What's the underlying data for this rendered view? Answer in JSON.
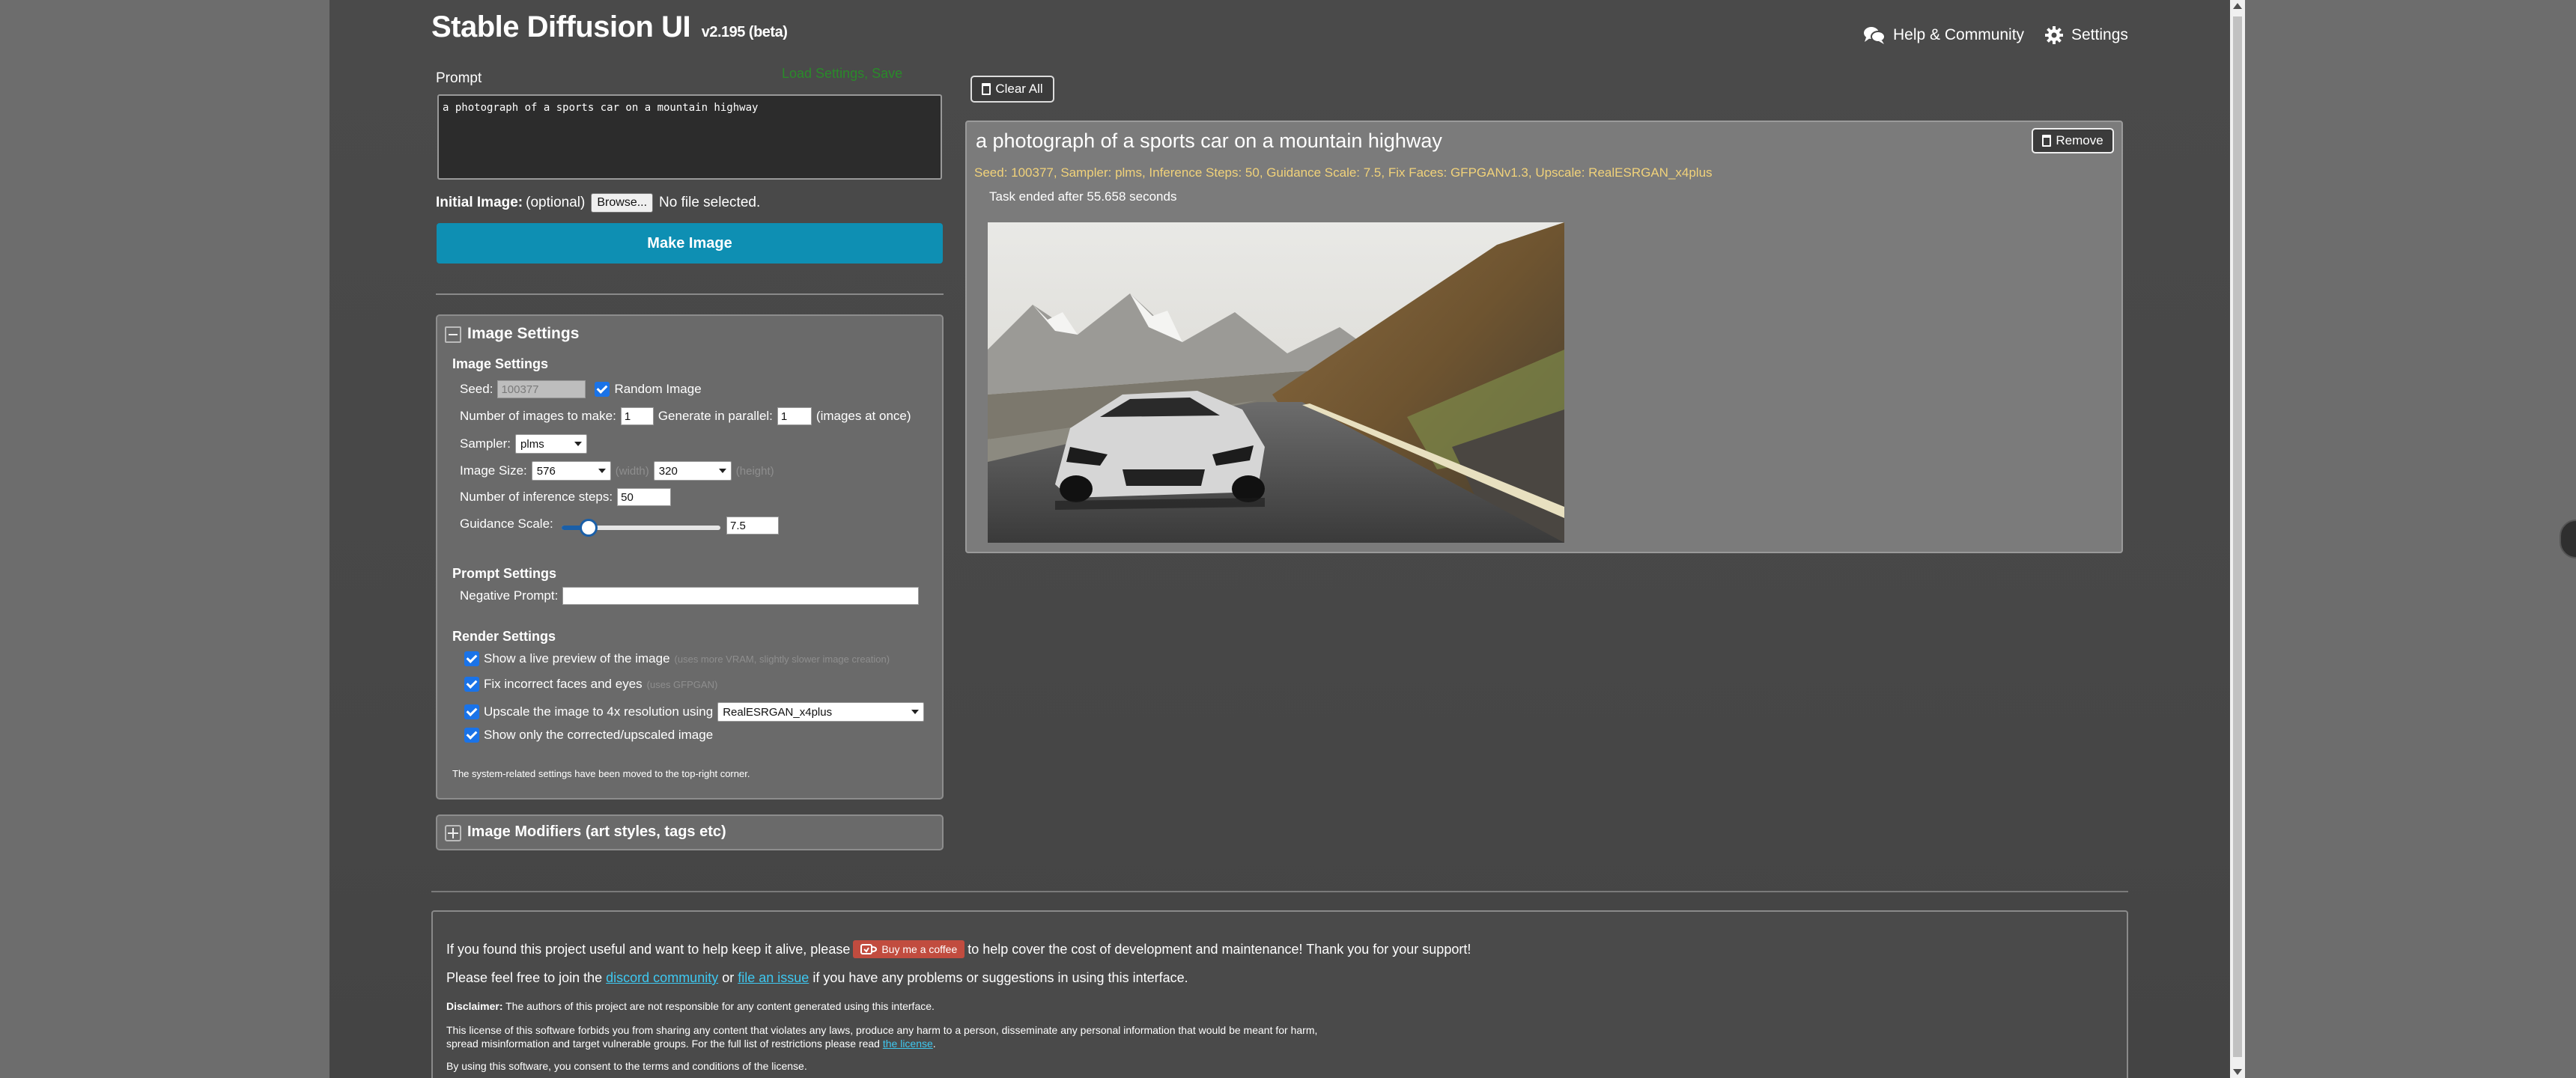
{
  "header": {
    "title": "Stable Diffusion UI",
    "version": "v2.195 (beta)",
    "help_label": "Help & Community",
    "settings_label": "Settings"
  },
  "prompt": {
    "label": "Prompt",
    "save_link": "Load Settings, Save",
    "value": "a photograph of a sports car on a mountain highway"
  },
  "initial_image": {
    "label": "Initial Image:",
    "optional": "(optional)",
    "browse": "Browse...",
    "status": "No file selected."
  },
  "make_image_label": "Make Image",
  "image_settings": {
    "panel_title": "Image Settings",
    "section_title": "Image Settings",
    "seed_label": "Seed:",
    "seed_value": "100377",
    "random_label": "Random Image",
    "num_images_label": "Number of images to make:",
    "num_images_value": "1",
    "parallel_label": "Generate in parallel:",
    "parallel_value": "1",
    "parallel_hint": "(images at once)",
    "sampler_label": "Sampler:",
    "sampler_value": "plms",
    "size_label": "Image Size:",
    "width_value": "576",
    "width_hint": "(width)",
    "height_value": "320",
    "height_hint": "(height)",
    "steps_label": "Number of inference steps:",
    "steps_value": "50",
    "guidance_label": "Guidance Scale:",
    "guidance_value": "7.5",
    "guidance_fraction": 0.17,
    "prompt_settings_title": "Prompt Settings",
    "negative_label": "Negative Prompt:",
    "negative_value": "",
    "render_title": "Render Settings",
    "live_preview_label": "Show a live preview of the image",
    "live_preview_hint": "(uses more VRAM, slightly slower image creation)",
    "fix_faces_label": "Fix incorrect faces and eyes",
    "fix_faces_hint": "(uses GFPGAN)",
    "upscale_label": "Upscale the image to 4x resolution using",
    "upscale_value": "RealESRGAN_x4plus",
    "only_corrected_label": "Show only the corrected/upscaled image",
    "note": "The system-related settings have been moved to the top-right corner."
  },
  "modifiers_title": "Image Modifiers (art styles, tags etc)",
  "clear_all_label": "Clear All",
  "result": {
    "title": "a photograph of a sports car on a mountain highway",
    "remove_label": "Remove",
    "meta": "Seed: 100377, Sampler: plms, Inference Steps: 50, Guidance Scale: 7.5, Fix Faces: GFPGANv1.3, Upscale: RealESRGAN_x4plus",
    "task": "Task ended after 55.658 seconds"
  },
  "footer": {
    "support_pre": "If you found this project useful and want to help keep it alive, please",
    "coffee_label": "Buy me a coffee",
    "support_post": "to help cover the cost of development and maintenance! Thank you for your support!",
    "join_pre": "Please feel free to join the",
    "discord_link": "discord community",
    "join_or": "or",
    "issue_link": "file an issue",
    "join_post": "if you have any problems or suggestions in using this interface.",
    "disclaimer_label": "Disclaimer:",
    "disclaimer_text": "The authors of this project are not responsible for any content generated using this interface.",
    "license_line1": "This license of this software forbids you from sharing any content that violates any laws, produce any harm to a person, disseminate any personal information that would be meant for harm,",
    "license_line2": "spread misinformation and target vulnerable groups. For the full list of restrictions please read",
    "license_link": "the license",
    "consent": "By using this software, you consent to the terms and conditions of the license."
  },
  "colors": {
    "accent": "#0e8fb3",
    "meta_text": "#f1d27a",
    "link": "#3ec8f0",
    "coffee": "#c14c3f"
  }
}
